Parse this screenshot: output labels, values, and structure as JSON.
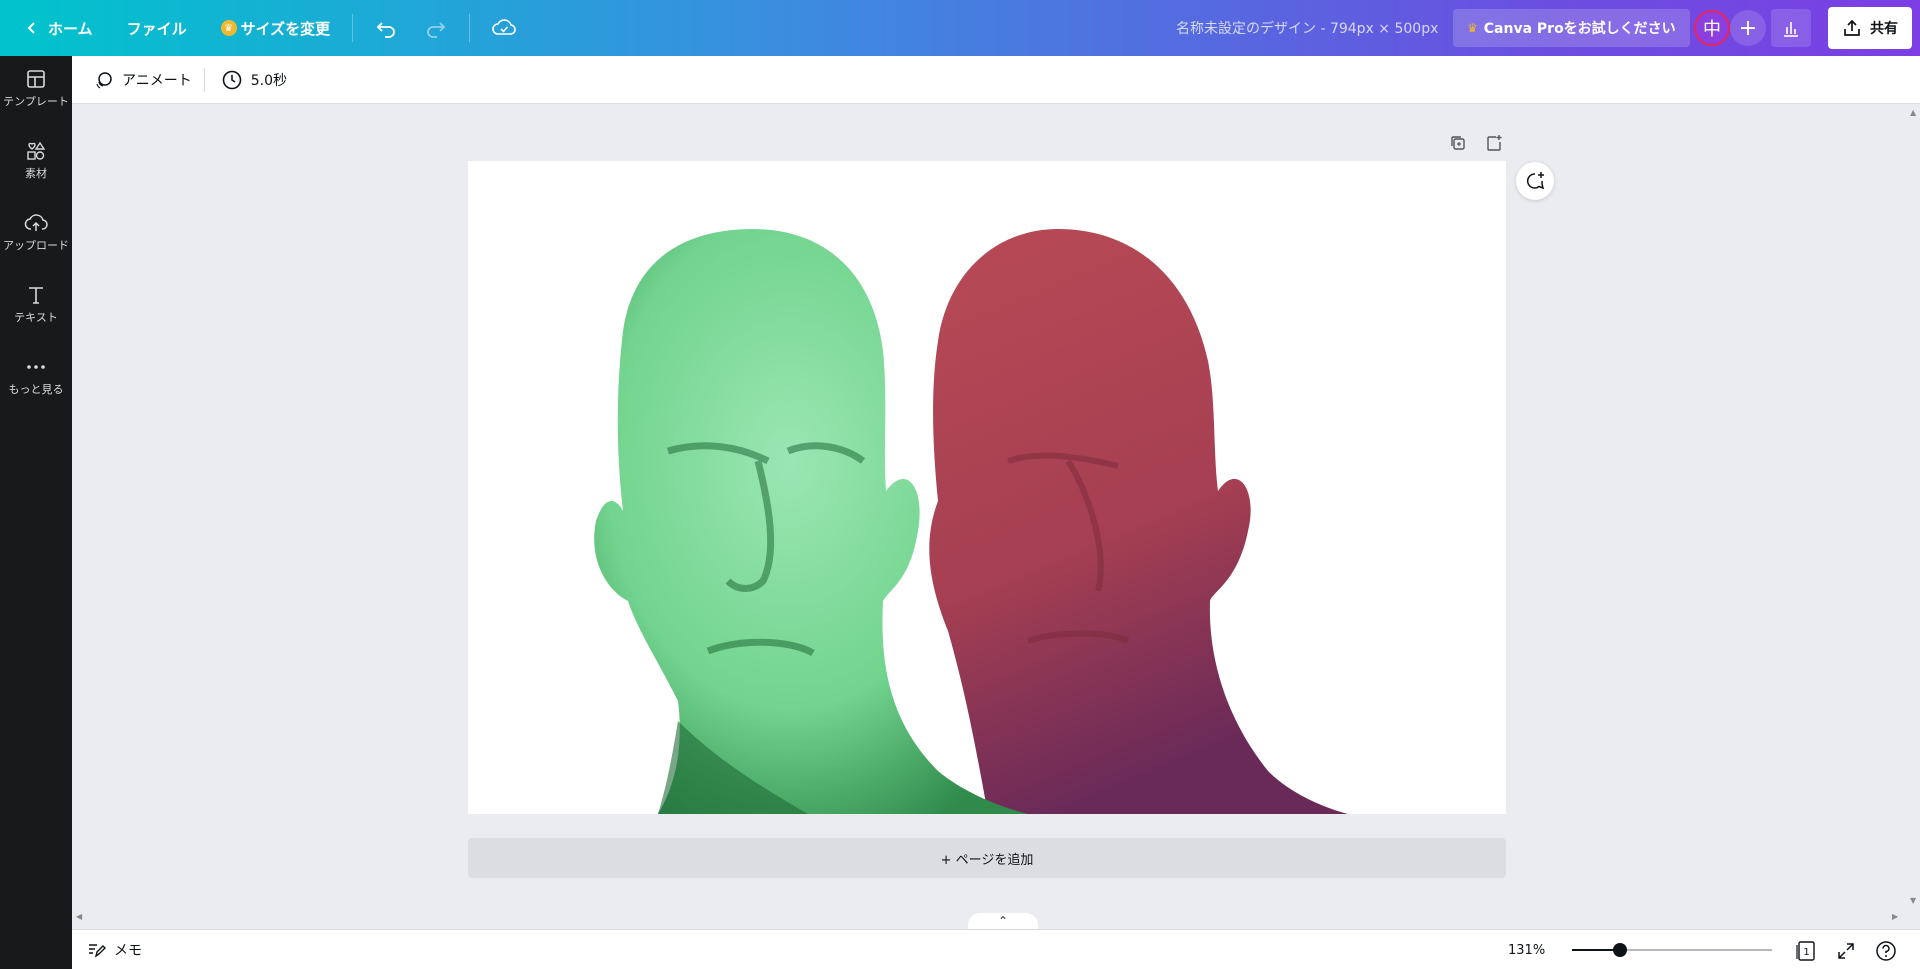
{
  "topbar": {
    "home_label": "ホーム",
    "file_label": "ファイル",
    "resize_label": "サイズを変更",
    "doc_title": "名称未設定のデザイン - 794px × 500px",
    "pro_label": "Canva Proをお試しください",
    "avatar_initial": "中",
    "share_label": "共有"
  },
  "sidebar": {
    "items": [
      {
        "label": "テンプレート",
        "icon": "template-icon"
      },
      {
        "label": "素材",
        "icon": "elements-icon"
      },
      {
        "label": "アップロード",
        "icon": "upload-icon"
      },
      {
        "label": "テキスト",
        "icon": "text-icon"
      },
      {
        "label": "もっと見る",
        "icon": "more-icon"
      }
    ]
  },
  "context_toolbar": {
    "animate_label": "アニメート",
    "duration_label": "5.0秒"
  },
  "canvas": {
    "add_page_label": "+ ページを追加",
    "image_subjects": [
      "green-tinted head",
      "red-tinted head"
    ]
  },
  "bottombar": {
    "notes_label": "メモ",
    "zoom_label": "131%",
    "zoom_fraction": 0.24,
    "page_count": "1"
  },
  "colors": {
    "gradient_start": "#00c4cc",
    "gradient_end": "#7b3fe4",
    "sidebar_bg": "#18191b",
    "green_head": "#7fdc9c",
    "red_head": "#b84a55"
  }
}
